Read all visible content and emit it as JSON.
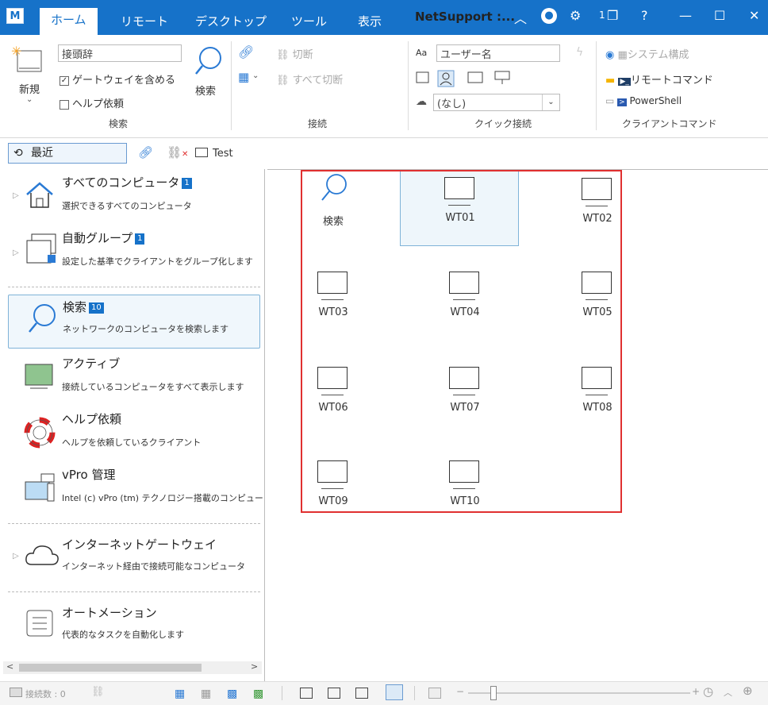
{
  "window": {
    "app_icon": "M",
    "title": "NetSupport :...",
    "tabs": [
      "ホーム",
      "リモート",
      "デスクトップ",
      "ツール",
      "表示"
    ],
    "active_tab": 0,
    "notification_count": "1",
    "help": "?",
    "accent": "#1672c9"
  },
  "ribbon": {
    "new_label": "新規",
    "prefix_input": "接頭辞",
    "include_gateway": "ゲートウェイを含める",
    "help_request": "ヘルプ依頼",
    "search_button": "検索",
    "search_group": "検索",
    "disconnect": "切断",
    "disconnect_all": "すべて切断",
    "connect_group": "接続",
    "username_placeholder": "ユーザー名",
    "aa": "Aa",
    "none_option": "(なし)",
    "quick_connect_group": "クイック接続",
    "system_config": "システム構成",
    "remote_command": "リモートコマンド",
    "powershell": "PowerShell",
    "client_command_group": "クライアントコマンド"
  },
  "quickbar": {
    "recent": "最近",
    "test": "Test"
  },
  "sidebar": {
    "items": [
      {
        "title": "すべてのコンピュータ",
        "badge": "1",
        "desc": "選択できるすべてのコンピュータ"
      },
      {
        "title": "自動グループ",
        "badge": "1",
        "desc": "設定した基準でクライアントをグループ化します"
      },
      {
        "title": "検索",
        "badge": "10",
        "desc": "ネットワークのコンピュータを検索します"
      },
      {
        "title": "アクティブ",
        "badge": "",
        "desc": "接続しているコンピュータをすべて表示します"
      },
      {
        "title": "ヘルプ依頼",
        "badge": "",
        "desc": "ヘルプを依頼しているクライアント"
      },
      {
        "title": "vPro 管理",
        "badge": "",
        "desc": "Intel (c) vPro (tm) テクノロジー搭載のコンピュー"
      },
      {
        "title": "インターネットゲートウェイ",
        "badge": "",
        "desc": "インターネット経由で接続可能なコンピュータ"
      },
      {
        "title": "オートメーション",
        "badge": "",
        "desc": "代表的なタスクを自動化します"
      }
    ]
  },
  "main": {
    "tiles": [
      "検索",
      "WT01",
      "WT02",
      "WT03",
      "WT04",
      "WT05",
      "WT06",
      "WT07",
      "WT08",
      "WT09",
      "WT10"
    ],
    "selected": "WT01"
  },
  "statusbar": {
    "connections": "接続数 : 0"
  }
}
